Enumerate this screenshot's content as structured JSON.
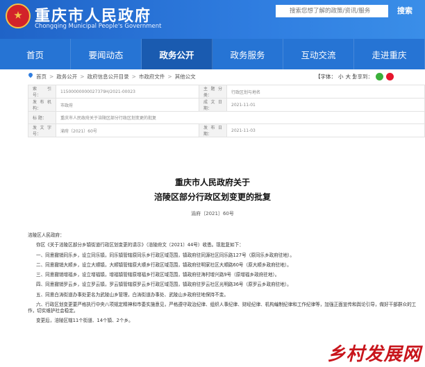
{
  "header": {
    "site_title": "重庆市人民政府",
    "site_subtitle": "Chongqing Municipal People's Government",
    "search_placeholder": "搜索您想了解的政策/资讯/服务",
    "search_button": "搜索"
  },
  "nav": {
    "items": [
      {
        "label": "首页",
        "active": false
      },
      {
        "label": "要闻动态",
        "active": false
      },
      {
        "label": "政务公开",
        "active": true
      },
      {
        "label": "政务服务",
        "active": false
      },
      {
        "label": "互动交流",
        "active": false
      },
      {
        "label": "走进重庆",
        "active": false
      }
    ]
  },
  "breadcrumb": {
    "items": [
      "首页",
      "政务公开",
      "政府信息公开目录",
      "市政府文件",
      "其他公文"
    ],
    "font_size_label": "【字体：",
    "font_small": "小",
    "font_large": "大",
    "font_close": "】",
    "share_label": "分享到："
  },
  "meta": {
    "index_no_label": "索 引 号：",
    "index_no_value": "11500000000027379H/2021-00023",
    "topic_label": "主题分类：",
    "topic_value": "行政区划与地名",
    "issuer_label": "发布机构：",
    "issuer_value": "市政府",
    "date_label": "成文日期：",
    "date_value": "2021-11-01",
    "title_label": "标 题：",
    "title_value": "重庆市人民政府关于涪陵区部分行政区划变更的批复",
    "doc_no_label": "发文字号：",
    "doc_no_value": "渝府〔2021〕60号",
    "pub_date_label": "发布日期：",
    "pub_date_value": "2021-11-03"
  },
  "article": {
    "title_line1": "重庆市人民政府关于",
    "title_line2": "涪陵区部分行政区划变更的批复",
    "doc_number": "渝府〔2021〕60号",
    "salutation": "涪陵区人民政府：",
    "paragraphs": [
      "你区《关于涪陵区部分乡镇街道行政区划变更的请示》（涪陵府文〔2021〕44号）收悉。现批复如下：",
      "一、同意撤销同乐乡，设立同乐镇，同乐镇管辖原同乐乡行政区域范围，镇政府驻同源社区同乐路127号（原同乐乡政府驻地）。",
      "二、同意撤销大顺乡，设立大顺镇，大顺镇管辖原大顺乡行政区域范围，镇政府驻明家社区大顺路60号（原大顺乡政府驻地）。",
      "三、同意撤销增福乡，设立增福镇，增福镇管辖原增福乡行政区域范围，镇政府驻海村增兴路9号（原增福乡政府驻地）。",
      "四、同意撤销罗云乡，设立罗云镇，罗云镇管辖原罗云乡行政区域范围，镇政府驻罗云社区光明路36号（原罗云乡政府驻地）。",
      "五、同意白涛街道办事处更名为武陵山乡管理，白涛街道办事处、武陵山乡政府驻地保持不变。",
      "六、行政区划变更要严格执行中央八项规定精神和市委实施意见，严格遵守政治纪律、组织人事纪律、财经纪律、机构编制纪律和工作纪律等，加强正面宣传和舆论引导，做好干部群众的工作，切实维护社会稳定。",
      "变更后，涪陵区辖11个街道、14个镇、2个乡。"
    ]
  },
  "watermark": {
    "text": "乡村发展网",
    "color": "#c8141b"
  },
  "colors": {
    "header_blue": "#2f7de0",
    "nav_blue": "#2674d4",
    "nav_active": "#1a5bb0"
  }
}
